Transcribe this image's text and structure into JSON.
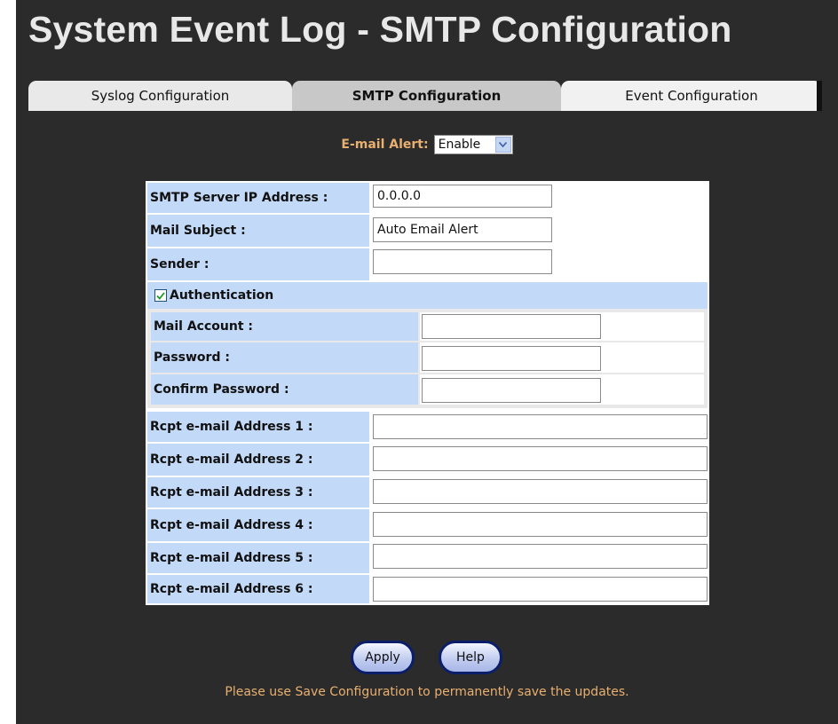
{
  "page_title": "System Event Log - SMTP Configuration",
  "tabs": [
    {
      "label": "Syslog Configuration",
      "active": false
    },
    {
      "label": "SMTP Configuration",
      "active": true
    },
    {
      "label": "Event Configuration",
      "active": false
    }
  ],
  "email_alert": {
    "label": "E-mail Alert:",
    "value": "Enable",
    "icon": "chevron-down-icon"
  },
  "form": {
    "smtp_server_label": "SMTP Server IP Address :",
    "smtp_server_value": "0.0.0.0",
    "mail_subject_label": "Mail Subject :",
    "mail_subject_value": "Auto Email Alert",
    "sender_label": "Sender :",
    "sender_value": "",
    "authentication": {
      "label": "Authentication",
      "checked": true,
      "mail_account_label": "Mail Account :",
      "mail_account_value": "",
      "password_label": "Password :",
      "password_value": "",
      "confirm_password_label": "Confirm Password :",
      "confirm_password_value": ""
    },
    "recipients": [
      {
        "label": "Rcpt e-mail Address 1 :",
        "value": ""
      },
      {
        "label": "Rcpt e-mail Address 2 :",
        "value": ""
      },
      {
        "label": "Rcpt e-mail Address 3 :",
        "value": ""
      },
      {
        "label": "Rcpt e-mail Address 4 :",
        "value": ""
      },
      {
        "label": "Rcpt e-mail Address 5 :",
        "value": ""
      },
      {
        "label": "Rcpt e-mail Address 6 :",
        "value": ""
      }
    ]
  },
  "buttons": {
    "apply": "Apply",
    "help": "Help"
  },
  "note": "Please use Save Configuration to permanently save the updates.",
  "colors": {
    "background": "#2b2b2b",
    "label_bg": "#c2d9f7",
    "accent_text": "#e8b070",
    "button_border": "#0a1e6a"
  }
}
